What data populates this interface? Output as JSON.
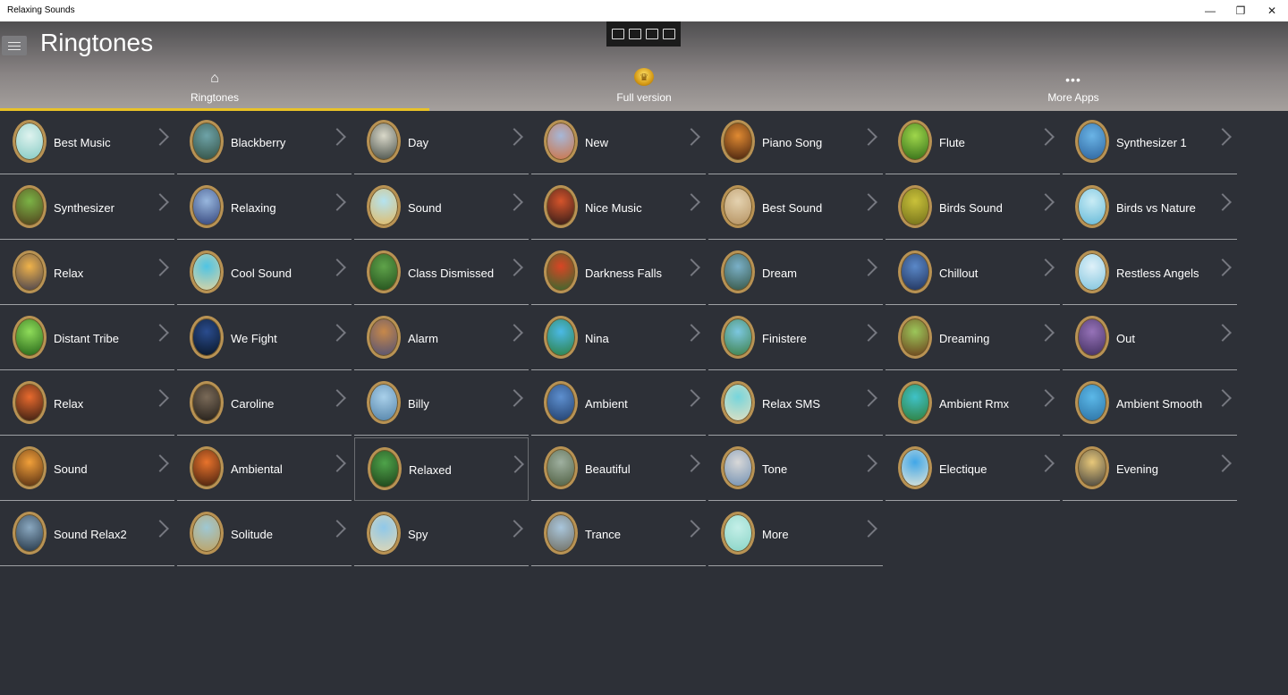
{
  "window": {
    "title": "Relaxing Sounds",
    "min_glyph": "—",
    "max_glyph": "❐",
    "close_glyph": "✕"
  },
  "header": {
    "menu_icon": "hamburger-icon",
    "title": "Ringtones",
    "tabs": [
      {
        "label": "Ringtones",
        "icon": "home-icon",
        "active": true
      },
      {
        "label": "Full version",
        "icon": "crown-icon",
        "active": false
      },
      {
        "label": "More Apps",
        "icon": "more-dots-icon",
        "active": false
      }
    ]
  },
  "colors": {
    "accent": "#e9c227",
    "background": "#2d3037",
    "frame": "#b89253"
  },
  "ringtones": [
    [
      {
        "label": "Best Music",
        "thumb": [
          "#dff3ef",
          "#7fc7c0"
        ]
      },
      {
        "label": "Blackberry",
        "thumb": [
          "#6ea3a8",
          "#2e4a3c"
        ]
      },
      {
        "label": "Day",
        "thumb": [
          "#d9d8c9",
          "#3e4640"
        ]
      },
      {
        "label": "New",
        "thumb": [
          "#a6b7d8",
          "#d0703e"
        ]
      },
      {
        "label": "Piano Song",
        "thumb": [
          "#e08a32",
          "#3a1a0c"
        ]
      },
      {
        "label": "Flute",
        "thumb": [
          "#9fd64b",
          "#2b6615"
        ]
      },
      {
        "label": "Synthesizer 1",
        "thumb": [
          "#6ab4e6",
          "#2a5f99"
        ]
      }
    ],
    [
      {
        "label": "Synthesizer",
        "thumb": [
          "#7bb346",
          "#4e3a1a"
        ]
      },
      {
        "label": "Relaxing",
        "thumb": [
          "#98b7de",
          "#2d3d74"
        ]
      },
      {
        "label": "Sound",
        "thumb": [
          "#b4e3f0",
          "#e4b85e"
        ]
      },
      {
        "label": "Nice Music",
        "thumb": [
          "#d5542b",
          "#251818"
        ]
      },
      {
        "label": "Best Sound",
        "thumb": [
          "#e4d2b0",
          "#b28e5c"
        ]
      },
      {
        "label": "Birds Sound",
        "thumb": [
          "#c9c13a",
          "#6c6a18"
        ]
      },
      {
        "label": "Birds vs Nature",
        "thumb": [
          "#c9ecf5",
          "#5fb6d6"
        ]
      }
    ],
    [
      {
        "label": "Relax",
        "thumb": [
          "#f0b34a",
          "#3c3a4f"
        ]
      },
      {
        "label": "Cool Sound",
        "thumb": [
          "#4fc4e4",
          "#e8d49d"
        ]
      },
      {
        "label": "Class Dismissed",
        "thumb": [
          "#5fa34a",
          "#1f4a1a"
        ]
      },
      {
        "label": "Darkness Falls",
        "thumb": [
          "#d94524",
          "#2c6c30"
        ]
      },
      {
        "label": "Dream",
        "thumb": [
          "#7ab0c8",
          "#33513e"
        ]
      },
      {
        "label": "Chillout",
        "thumb": [
          "#5a88c8",
          "#1d2d54"
        ]
      },
      {
        "label": "Restless Angels",
        "thumb": [
          "#dff1f9",
          "#7cc2dc"
        ]
      }
    ],
    [
      {
        "label": "Distant Tribe",
        "thumb": [
          "#8fdc5a",
          "#1e5c14"
        ]
      },
      {
        "label": "We Fight",
        "thumb": [
          "#2a4c8e",
          "#07121f"
        ]
      },
      {
        "label": "Alarm",
        "thumb": [
          "#c7884a",
          "#4a4e78"
        ]
      },
      {
        "label": "Nina",
        "thumb": [
          "#4bb9e6",
          "#2c7d3a"
        ]
      },
      {
        "label": "Finistere",
        "thumb": [
          "#7cc7e0",
          "#3a7c3f"
        ]
      },
      {
        "label": "Dreaming",
        "thumb": [
          "#9bc65a",
          "#6a3a18"
        ]
      },
      {
        "label": "Out",
        "thumb": [
          "#9672b8",
          "#3c2b5a"
        ]
      }
    ],
    [
      {
        "label": "Relax",
        "thumb": [
          "#e86a2e",
          "#2a1810"
        ]
      },
      {
        "label": "Caroline",
        "thumb": [
          "#7a6a58",
          "#1c1814"
        ]
      },
      {
        "label": "Billy",
        "thumb": [
          "#a9d0ea",
          "#4e7ea4"
        ]
      },
      {
        "label": "Ambient",
        "thumb": [
          "#5d8fcf",
          "#1e3a66"
        ]
      },
      {
        "label": "Relax SMS",
        "thumb": [
          "#76d5dc",
          "#e8e0c0"
        ]
      },
      {
        "label": "Ambient Rmx",
        "thumb": [
          "#3fc2c8",
          "#2f7a32"
        ]
      },
      {
        "label": "Ambient Smooth",
        "thumb": [
          "#5bb8e8",
          "#2a6ea0"
        ]
      }
    ],
    [
      {
        "label": "Sound",
        "thumb": [
          "#f1a03a",
          "#4a2610"
        ]
      },
      {
        "label": "Ambiental",
        "thumb": [
          "#e8732c",
          "#3a1a0c"
        ]
      },
      {
        "label": "Relaxed",
        "thumb": [
          "#4ea34a",
          "#1a3a16"
        ]
      },
      {
        "label": "Beautiful",
        "thumb": [
          "#9fb0a0",
          "#4a5a3c"
        ]
      },
      {
        "label": "Tone",
        "thumb": [
          "#d8d8d8",
          "#6c8cb0"
        ]
      },
      {
        "label": "Electique",
        "thumb": [
          "#41a7e8",
          "#e8e8d8"
        ]
      },
      {
        "label": "Evening",
        "thumb": [
          "#e8c87a",
          "#3a3a3a"
        ]
      }
    ],
    [
      {
        "label": "Sound Relax2",
        "thumb": [
          "#8aa8c0",
          "#1e2e3e"
        ]
      },
      {
        "label": "Solitude",
        "thumb": [
          "#9ec8d4",
          "#c2a05a"
        ]
      },
      {
        "label": "Spy",
        "thumb": [
          "#8fc8ea",
          "#e6d8b0"
        ]
      },
      {
        "label": "Trance",
        "thumb": [
          "#a9c6dc",
          "#6e6a5c"
        ]
      },
      {
        "label": "More",
        "thumb": [
          "#c4efe8",
          "#86d2c4"
        ]
      }
    ]
  ]
}
